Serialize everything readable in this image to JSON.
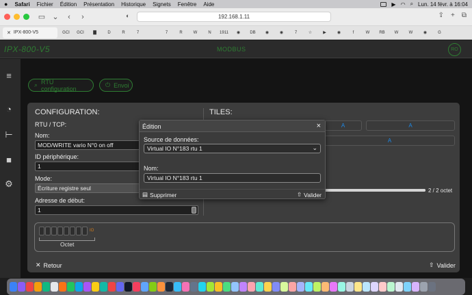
{
  "menubar": {
    "apple": "",
    "items": [
      "Safari",
      "Fichier",
      "Édition",
      "Présentation",
      "Historique",
      "Signets",
      "Fenêtre",
      "Aide"
    ],
    "clock": "Lun. 14 févr. à 16:04"
  },
  "browser": {
    "address": "192.168.1.11",
    "tab_label": "IPX-800-V5",
    "favorites": [
      "GCI",
      "GCI",
      "▇",
      "D",
      "R",
      "7",
      "",
      "7",
      "R",
      "W",
      "N",
      "1911",
      "◉",
      "DB",
      "◉",
      "◉",
      "7",
      "☆",
      "▶",
      "◉",
      "f",
      "W",
      "RB",
      "W",
      "W",
      "◉",
      "G"
    ]
  },
  "app": {
    "title": "IPX-800-V5",
    "mode": "MODBUS",
    "avatar": "RO",
    "rtu_button": "RTU configuration",
    "envoi_button": "Envoi"
  },
  "config": {
    "heading": "CONFIGURATION:",
    "protocol": "RTU / TCP:",
    "nom_label": "Nom:",
    "nom_value": "MOD/WRITE vario N°0 on off",
    "id_label": "ID périphérique:",
    "id_value": "1",
    "mode_label": "Mode:",
    "mode_value": "Écriture registre seul",
    "adresse_label": "Adresse de début:",
    "adresse_value": "1",
    "octet_label": "Octet",
    "io_tag": "IO"
  },
  "tiles": {
    "heading": "TILES:",
    "tile_letter": "A",
    "count_text": "2 / 2 octet",
    "progress_fraction": 1.0
  },
  "footer": {
    "back": "Retour",
    "validate": "Valider"
  },
  "modal": {
    "title": "Édition",
    "close": "×",
    "source_label": "Source de données:",
    "source_value": "Virtual IO N°183 rtu 1",
    "nom_label": "Nom:",
    "nom_value": "Virtual IO N°183 rtu 1",
    "delete_label": "Supprimer",
    "validate_label": "Valider"
  },
  "colors": {
    "accent_green": "#2e7d32",
    "tile_blue": "#1e88e5",
    "io_orange": "#d17a1a"
  }
}
